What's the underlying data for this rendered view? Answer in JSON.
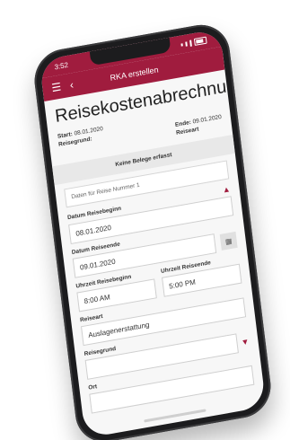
{
  "status": {
    "time": "3:52"
  },
  "nav": {
    "title": "RKA erstellen"
  },
  "page": {
    "title": "Reisekostenabrechnung",
    "start_label": "Start:",
    "start_value": "08.01.2020",
    "end_label": "Ende:",
    "end_value": "09.01.2020",
    "reisegrund_label": "Reisegrund:",
    "reiseart_label": "Reiseart",
    "banner": "Keine Belege erfasst",
    "section_title": "Daten für Reise Nummer 1"
  },
  "form": {
    "datum_reisebeginn_label": "Datum Reisebeginn",
    "datum_reisebeginn_value": "08.01.2020",
    "datum_reiseende_label": "Datum Reiseende",
    "datum_reiseende_value": "09.01.2020",
    "uhrzeit_beginn_label": "Uhrzeit Reisebeginn",
    "uhrzeit_beginn_value": "8:00 AM",
    "uhrzeit_ende_label": "Uhrzeit Reiseende",
    "uhrzeit_ende_value": "5:00 PM",
    "reiseart_label": "Reiseart",
    "reiseart_value": "Auslagenerstattung",
    "reisegrund_label": "Reisegrund",
    "ort_label": "Ort"
  },
  "colors": {
    "brand": "#a01c3e"
  }
}
